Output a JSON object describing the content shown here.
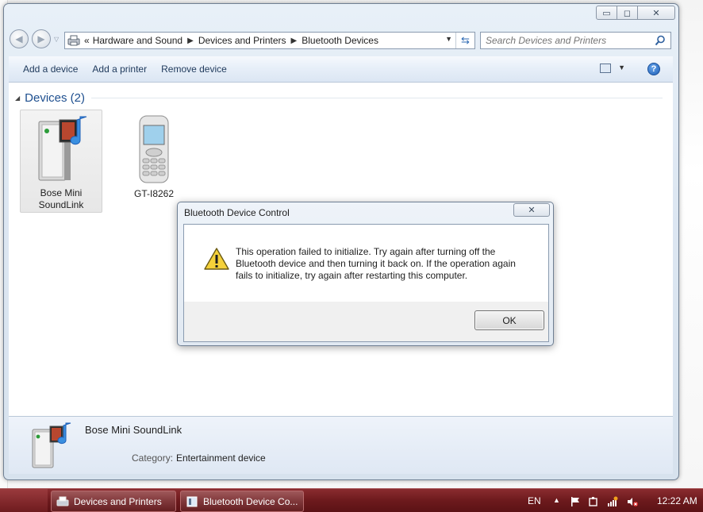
{
  "window": {
    "controls": {
      "minimize": "▭",
      "maximize": "◻",
      "close": "✕"
    }
  },
  "address_bar": {
    "overflow": "«",
    "crumbs": [
      "Hardware and Sound",
      "Devices and Printers",
      "Bluetooth Devices"
    ],
    "search_placeholder": "Search Devices and Printers"
  },
  "toolbar": {
    "add_device": "Add a device",
    "add_printer": "Add a printer",
    "remove_device": "Remove device",
    "help": "?"
  },
  "devices_group": {
    "title": "Devices (2)",
    "items": [
      {
        "label_line1": "Bose Mini",
        "label_line2": "SoundLink",
        "icon": "speaker-icon"
      },
      {
        "label_line1": "GT-I8262",
        "label_line2": "",
        "icon": "phone-icon"
      }
    ]
  },
  "details": {
    "name": "Bose Mini SoundLink",
    "category_label": "Category:",
    "category_value": "Entertainment device"
  },
  "dialog": {
    "title": "Bluetooth Device Control",
    "message": "This operation failed to initialize. Try again after turning off the Bluetooth device and then turning it back on. If the operation again fails to initialize, try again after restarting this computer.",
    "ok_label": "OK",
    "close_glyph": "✕"
  },
  "taskbar": {
    "tasks": [
      {
        "label": "Devices and Printers"
      },
      {
        "label": "Bluetooth Device Co..."
      }
    ],
    "language": "EN",
    "time": "12:22 AM"
  },
  "colors": {
    "taskbar": "#6d1a1d",
    "group_title": "#1e4f8f",
    "toolbar_text": "#1e395b"
  }
}
